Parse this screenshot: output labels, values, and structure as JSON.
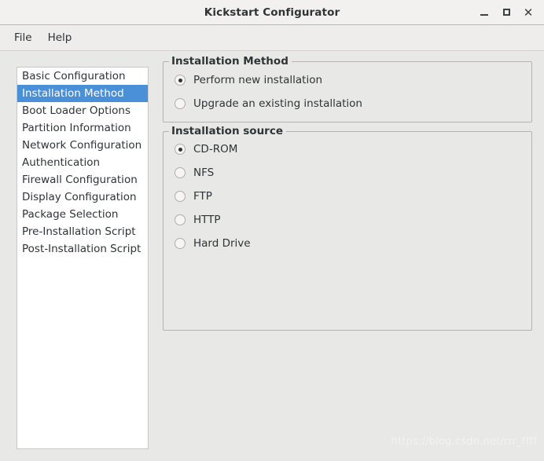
{
  "window": {
    "title": "Kickstart Configurator",
    "controls": {
      "minimize": "_",
      "maximize": "□",
      "close": "×"
    }
  },
  "menubar": {
    "items": [
      {
        "label": "File"
      },
      {
        "label": "Help"
      }
    ]
  },
  "sidebar": {
    "selected_index": 1,
    "items": [
      {
        "label": "Basic Configuration"
      },
      {
        "label": "Installation Method"
      },
      {
        "label": "Boot Loader Options"
      },
      {
        "label": "Partition Information"
      },
      {
        "label": "Network Configuration"
      },
      {
        "label": "Authentication"
      },
      {
        "label": "Firewall Configuration"
      },
      {
        "label": "Display Configuration"
      },
      {
        "label": "Package Selection"
      },
      {
        "label": "Pre-Installation Script"
      },
      {
        "label": "Post-Installation Script"
      }
    ]
  },
  "installation_method": {
    "title": "Installation Method",
    "options": [
      {
        "label": "Perform new installation",
        "checked": true
      },
      {
        "label": "Upgrade an existing installation",
        "checked": false
      }
    ]
  },
  "installation_source": {
    "title": "Installation source",
    "options": [
      {
        "label": "CD-ROM",
        "checked": true
      },
      {
        "label": "NFS",
        "checked": false
      },
      {
        "label": "FTP",
        "checked": false
      },
      {
        "label": "HTTP",
        "checked": false
      },
      {
        "label": "Hard Drive",
        "checked": false
      }
    ]
  },
  "watermark": {
    "text": "https://blog.csdn.net/rrr_ffff"
  },
  "colors": {
    "accent": "#4a90d9",
    "window_bg": "#e8e8e7",
    "titlebar_bg": "#f2f1f0",
    "text": "#2e3436"
  }
}
